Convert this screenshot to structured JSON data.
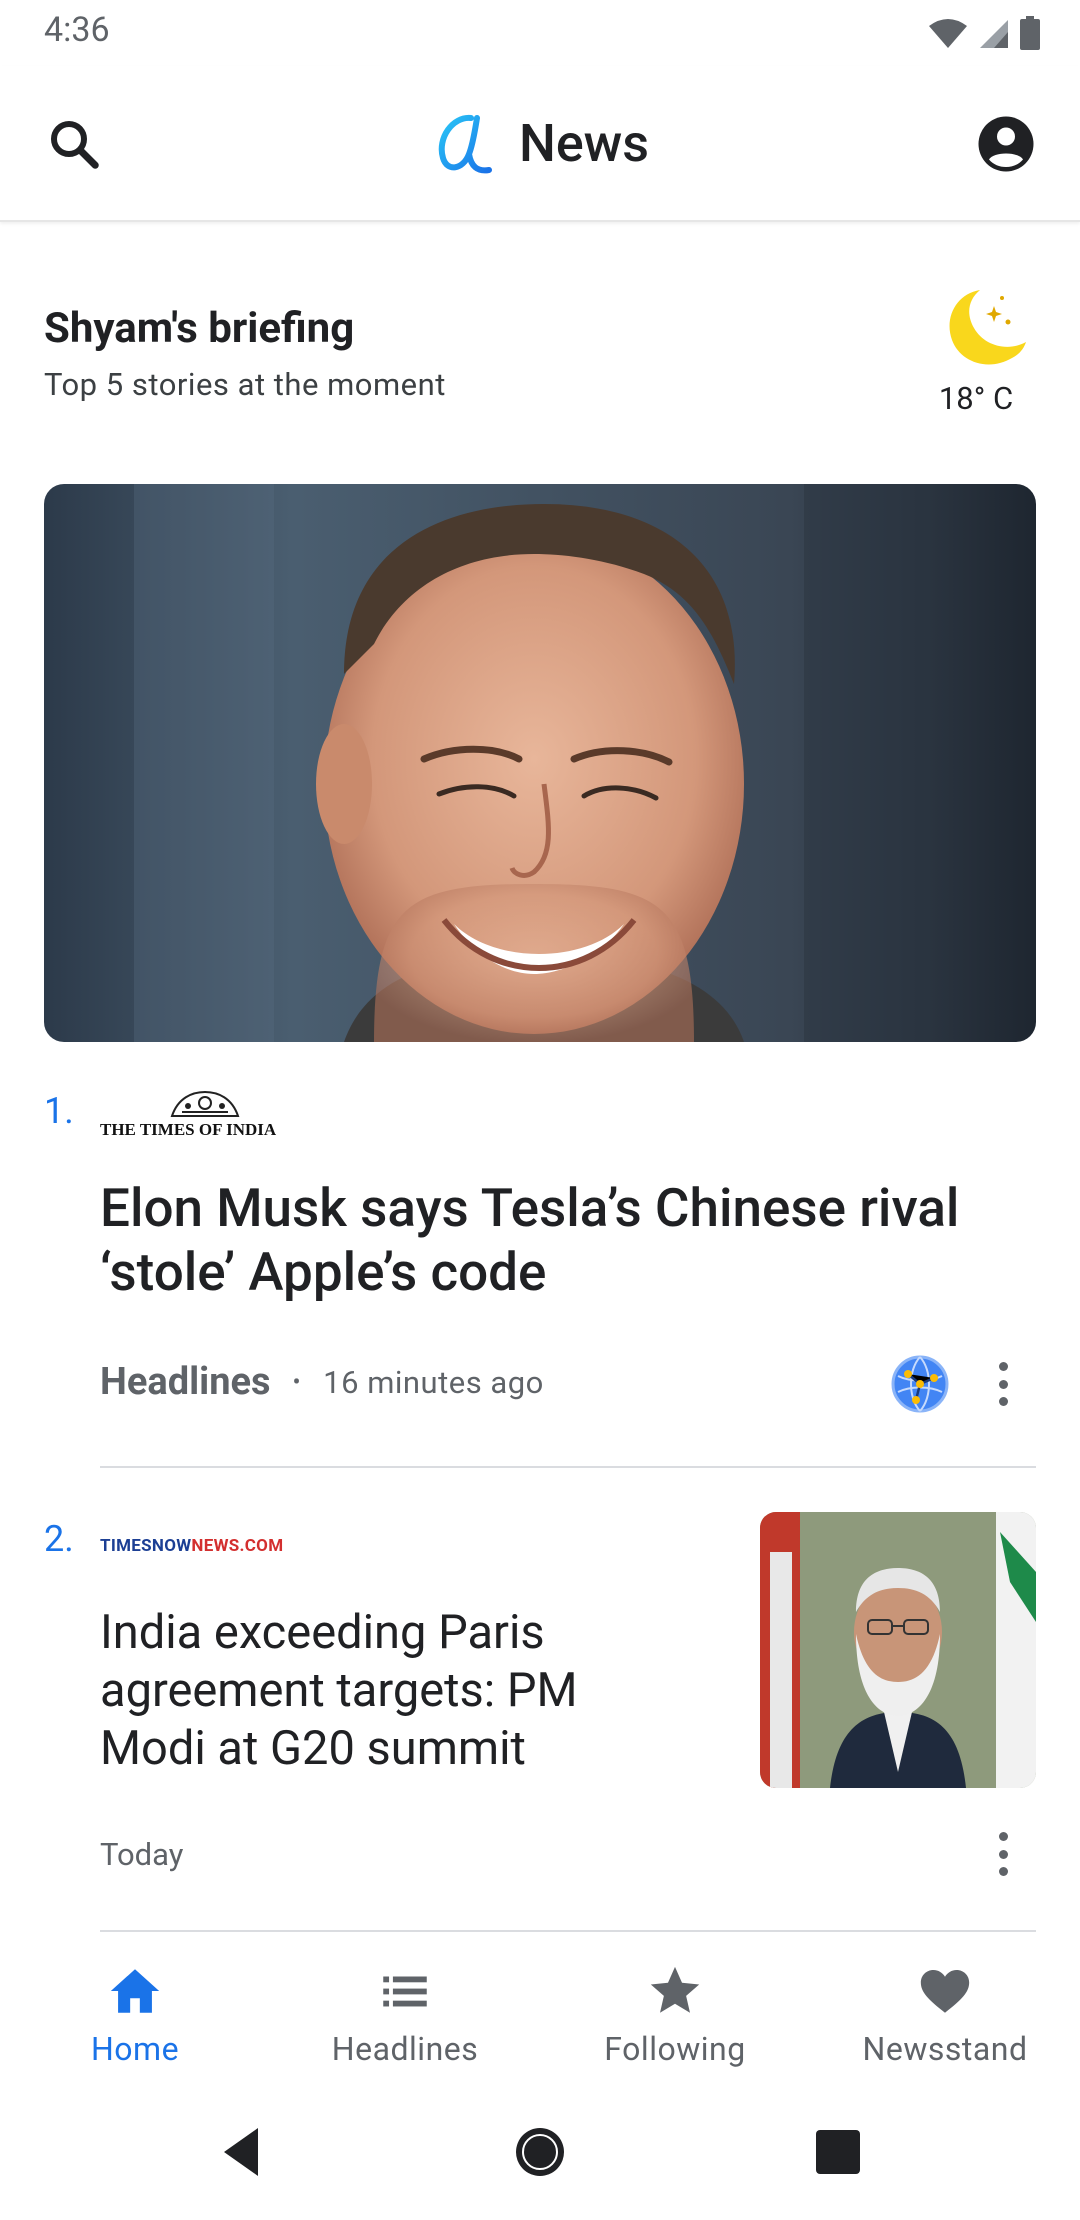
{
  "status_bar": {
    "time": "4:36",
    "icons": [
      "wifi-icon",
      "cell-signal-icon",
      "battery-icon"
    ]
  },
  "app_bar": {
    "title": "News",
    "search_icon": "search-icon",
    "account_icon": "account-circle-icon"
  },
  "briefing": {
    "title": "Shyam's briefing",
    "subtitle": "Top 5 stories at the moment",
    "weather": {
      "icon": "moon-stars-icon",
      "temperature": "18° C"
    }
  },
  "stories": [
    {
      "number": "1.",
      "source": "THE TIMES OF INDIA",
      "headline": "Elon Musk says Tesla’s Chinese rival ‘stole’ Apple’s code",
      "category": "Headlines",
      "separator": "•",
      "time": "16 minutes ago"
    },
    {
      "number": "2.",
      "source_part1": "TIMESNOW",
      "source_part2": "NEWS.COM",
      "headline": "India exceeding Paris agreement targets: PM Modi at G20 summit",
      "time": "Today"
    }
  ],
  "bottom_nav": [
    {
      "label": "Home",
      "icon": "home-icon",
      "active": true
    },
    {
      "label": "Headlines",
      "icon": "list-icon",
      "active": false
    },
    {
      "label": "Following",
      "icon": "star-icon",
      "active": false
    },
    {
      "label": "Newsstand",
      "icon": "heart-icon",
      "active": false
    }
  ],
  "colors": {
    "accent": "#1a73e8",
    "weather_moon": "#f9d71c",
    "text_primary": "#202124",
    "text_secondary": "#5f6368"
  }
}
